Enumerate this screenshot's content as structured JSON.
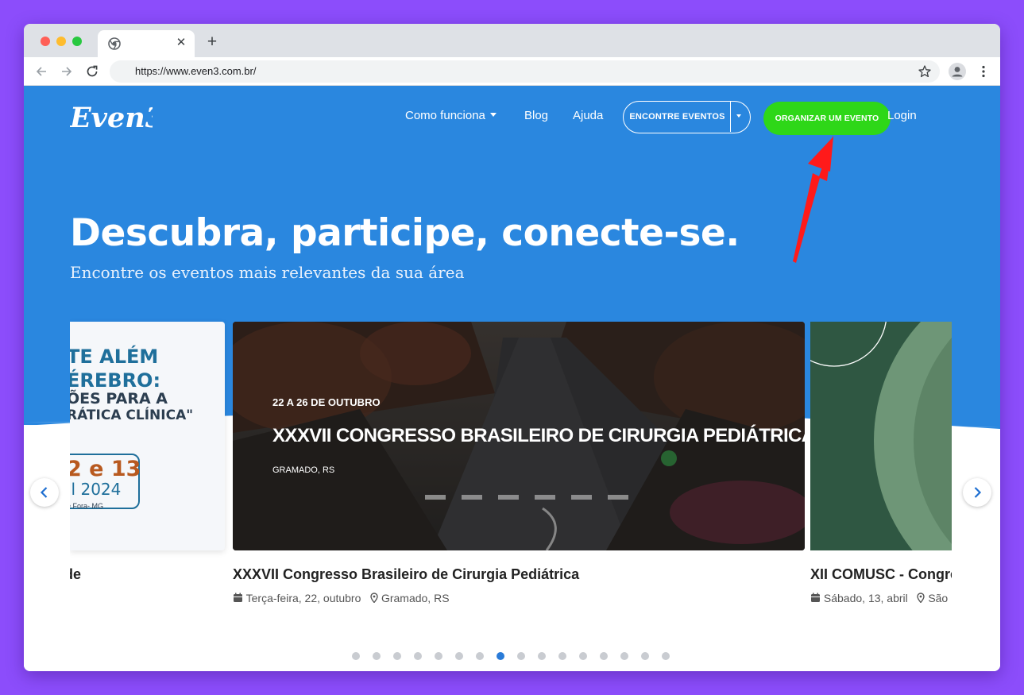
{
  "browser": {
    "url": "https://www.even3.com.br/"
  },
  "header": {
    "logo_text": "Even3",
    "nav": {
      "como_funciona": "Como funciona",
      "blog": "Blog",
      "ajuda": "Ajuda",
      "login": "Login"
    },
    "find_events_label": "ENCONTRE EVENTOS",
    "organize_label": "ORGANIZAR UM EVENTO"
  },
  "hero": {
    "title": "Descubra, participe, conecte-se.",
    "subtitle": "Encontre os eventos mais relevantes da sua área"
  },
  "carousel": {
    "left_card": {
      "title": "de",
      "image_text": {
        "line1": "TE ALÉM",
        "line2": "ÉREBRO:",
        "line3": "ÕES PARA A",
        "line4": "RÁTICA CLÍNICA\"",
        "date_line1": "2 e 13",
        "date_line2": "il 2024",
        "place": "e Fora- MG"
      }
    },
    "main_card": {
      "banner_date": "22 A 26 DE OUTUBRO",
      "banner_title": "XXXVII CONGRESSO BRASILEIRO DE CIRURGIA PEDIÁTRICA",
      "banner_location": "GRAMADO, RS",
      "title": "XXXVII Congresso Brasileiro de Cirurgia Pediátrica",
      "date": "Terça-feira, 22, outubro",
      "location": "Gramado, RS"
    },
    "right_card": {
      "title": "XII COMUSC - Congre",
      "date": "Sábado, 13, abril",
      "location": "São"
    },
    "dot_count": 16,
    "active_dot": 7
  },
  "colors": {
    "page_bg": "#8c4dfb",
    "hero_blue": "#2a87df",
    "organize_green": "#2ed718",
    "annotation_red": "#ff1a1a"
  }
}
